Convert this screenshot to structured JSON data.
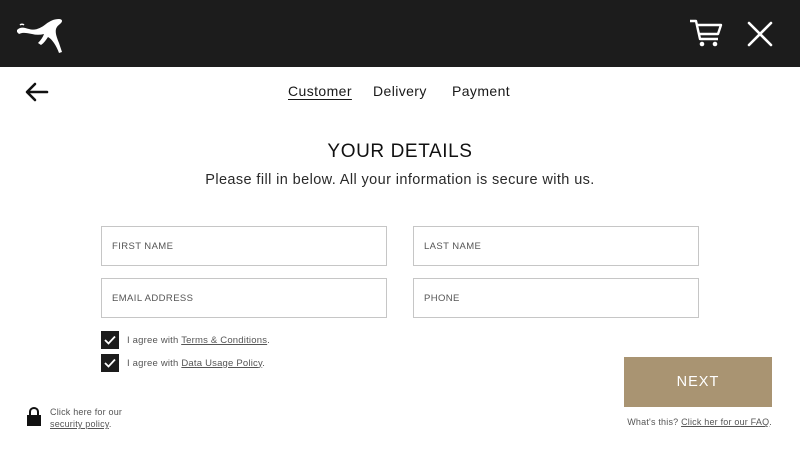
{
  "header": {
    "logo_icon": "puma-logo-icon",
    "cart_icon": "cart-icon",
    "close_icon": "close-icon",
    "background": "#1c1c1c"
  },
  "nav": {
    "back_icon": "arrow-left-icon",
    "steps": [
      {
        "label": "Customer",
        "active": true
      },
      {
        "label": "Delivery",
        "active": false
      },
      {
        "label": "Payment",
        "active": false
      }
    ]
  },
  "main": {
    "title": "YOUR DETAILS",
    "subtitle": "Please fill in below. All your information is secure with us.",
    "fields": {
      "first_name": {
        "placeholder": "FIRST NAME",
        "value": ""
      },
      "last_name": {
        "placeholder": "LAST NAME",
        "value": ""
      },
      "email": {
        "placeholder": "EMAIL ADDRESS",
        "value": ""
      },
      "phone": {
        "placeholder": "PHONE",
        "value": ""
      }
    },
    "agreements": [
      {
        "prefix": "I agree with ",
        "link": "Terms & Conditions",
        "suffix": ".",
        "checked": true
      },
      {
        "prefix": "I agree with ",
        "link": "Data Usage Policy",
        "suffix": ".",
        "checked": true
      }
    ],
    "next_label": "NEXT",
    "accent": "#a99472"
  },
  "footer": {
    "faq_prefix": "What's this? ",
    "faq_link": "Click her for our FAQ",
    "faq_suffix": ".",
    "security_line1": "Click here for our",
    "security_link": "security policy",
    "security_suffix": ".",
    "lock_icon": "lock-icon"
  }
}
